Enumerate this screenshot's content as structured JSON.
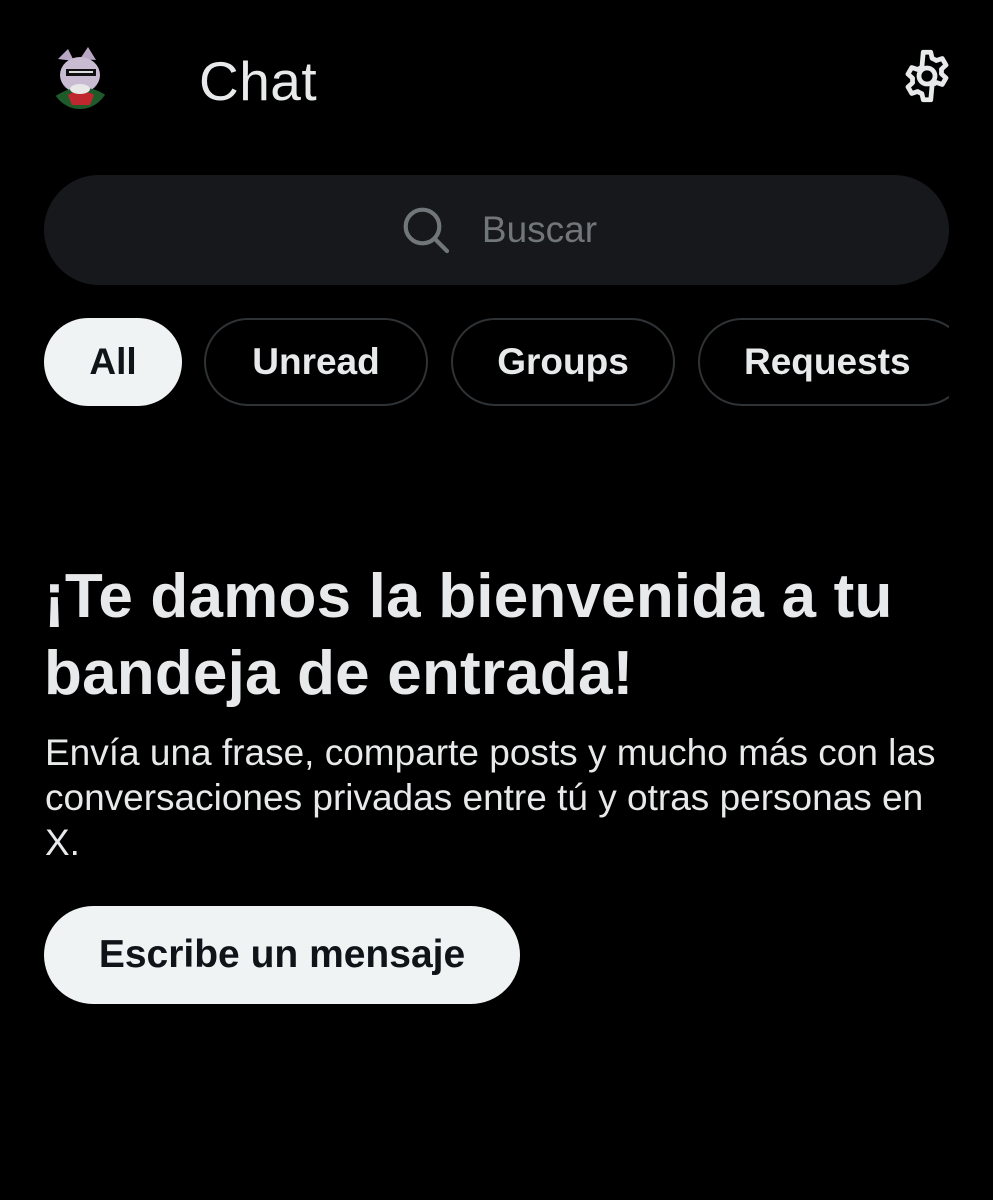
{
  "header": {
    "title": "Chat",
    "avatar_icon": "user-avatar",
    "settings_icon": "gear-icon"
  },
  "search": {
    "placeholder": "Buscar",
    "icon": "search-icon"
  },
  "filters": [
    {
      "label": "All",
      "active": true
    },
    {
      "label": "Unread",
      "active": false
    },
    {
      "label": "Groups",
      "active": false
    },
    {
      "label": "Requests",
      "active": false
    }
  ],
  "welcome": {
    "title": "¡Te damos la bienvenida a tu bandeja de entrada!",
    "description": "Envía una frase, comparte posts y mucho más con las conversaciones privadas entre tú y otras personas en X.",
    "cta_label": "Escribe un mensaje"
  },
  "colors": {
    "background": "#000000",
    "text": "#e7e9ea",
    "muted": "#71767b",
    "search_bg": "#16181c",
    "pill_border": "#2f3336",
    "button_bg": "#eff3f4",
    "button_text": "#0f1419"
  }
}
